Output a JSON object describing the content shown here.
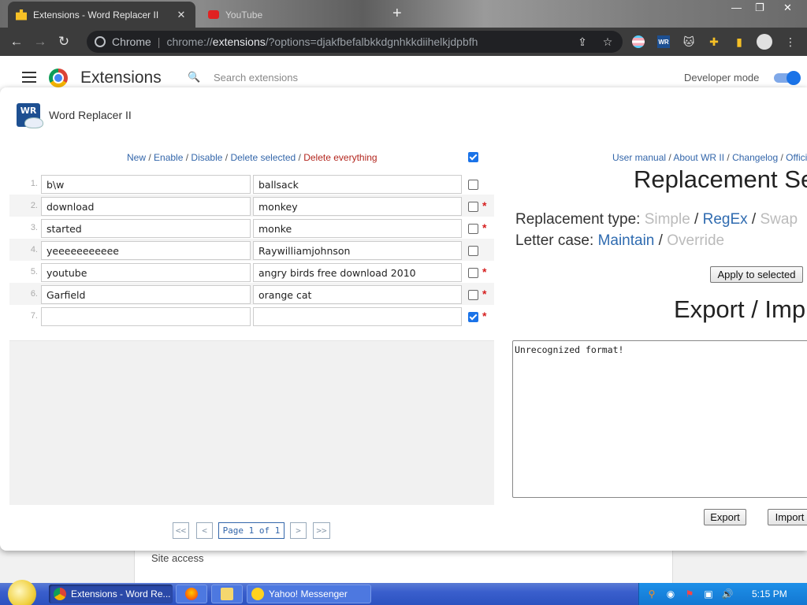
{
  "browser": {
    "tabs": [
      {
        "title": "Extensions - Word Replacer II",
        "active": true
      },
      {
        "title": "YouTube",
        "active": false
      }
    ],
    "address": {
      "site_label": "Chrome",
      "url_scheme": "chrome://",
      "url_host": "extensions",
      "url_rest": "/?options=djakfbefalbkkdgnhkkdiihelkjdpbfh"
    }
  },
  "extensions_page": {
    "title": "Extensions",
    "search_placeholder": "Search extensions",
    "developer_mode_label": "Developer mode",
    "developer_mode_on": true,
    "site_access_label": "Site access"
  },
  "dialog": {
    "extension_name": "Word Replacer II",
    "logo_text": "WR",
    "actions": {
      "new": "New",
      "enable": "Enable",
      "disable": "Disable",
      "delete_selected": "Delete selected",
      "delete_everything": "Delete everything",
      "separator": " / "
    },
    "rows": [
      {
        "num": "1.",
        "find": "b\\w",
        "replace": "ballsack",
        "checked": false,
        "flag": false
      },
      {
        "num": "2.",
        "find": "download",
        "replace": "monkey",
        "checked": false,
        "flag": true
      },
      {
        "num": "3.",
        "find": "started",
        "replace": "monke",
        "checked": false,
        "flag": true
      },
      {
        "num": "4.",
        "find": "yeeeeeeeeeee",
        "replace": "Raywilliamjohnson",
        "checked": false,
        "flag": false
      },
      {
        "num": "5.",
        "find": "youtube",
        "replace": "angry birds free download 2010",
        "checked": false,
        "flag": true
      },
      {
        "num": "6.",
        "find": "Garfield",
        "replace": "orange cat",
        "checked": false,
        "flag": true
      },
      {
        "num": "7.",
        "find": "",
        "replace": "",
        "checked": true,
        "flag": true
      }
    ],
    "pager": {
      "first": "<<",
      "prev": "<",
      "page_label": "Page 1 of 1",
      "next": ">",
      "last": ">>"
    },
    "right": {
      "links": [
        "User manual",
        "About WR II",
        "Changelog",
        "Offici"
      ],
      "replacement_heading": "Replacement Se",
      "replacement_type_label": "Replacement type:",
      "replacement_type_options": [
        "Simple",
        "RegEx",
        "Swap"
      ],
      "letter_case_label": "Letter case:",
      "letter_case_options": [
        "Maintain",
        "Override"
      ],
      "apply_button": "Apply to selected",
      "export_heading": "Export / Imp",
      "textarea_value": "Unrecognized format!",
      "export_button": "Export",
      "import_button": "Import"
    }
  },
  "taskbar": {
    "tasks": [
      {
        "label": "Extensions - Word Re...",
        "active": true
      },
      {
        "label": "",
        "active": false
      },
      {
        "label": "",
        "active": false
      },
      {
        "label": "Yahoo! Messenger",
        "active": false
      }
    ],
    "clock": "5:15 PM"
  },
  "colors": {
    "link_blue": "#3366aa",
    "danger_red": "#b3261e",
    "flag_red": "#d62020",
    "check_blue": "#1a73e8"
  }
}
